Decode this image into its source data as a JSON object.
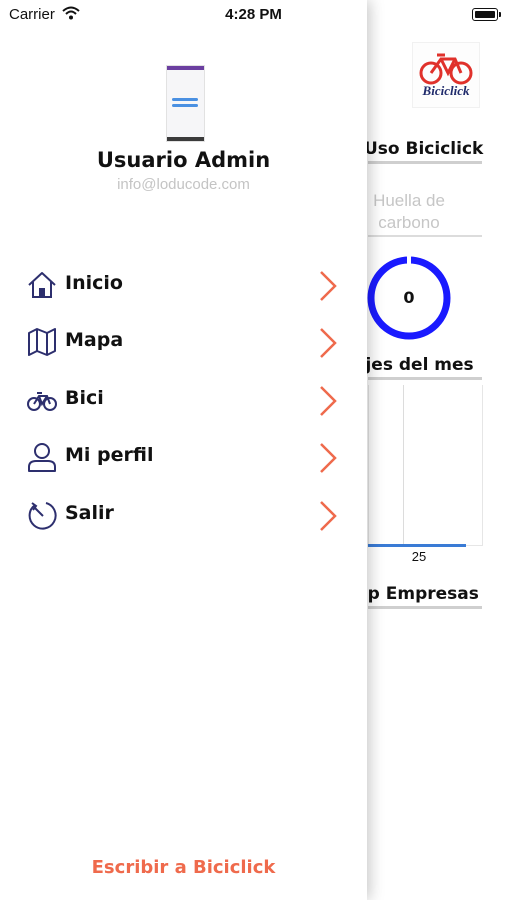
{
  "status_bar": {
    "carrier": "Carrier",
    "time": "4:28 PM"
  },
  "main": {
    "logo_text": "Biciclick",
    "uso_title": "Uso Biciclick",
    "huella_line1": "Huella de",
    "huella_line2": "carbono",
    "gauge_value": "0",
    "viajes_title": "ajes del mes",
    "chart_tick": "25",
    "empresas_title": "op Empresas"
  },
  "drawer": {
    "user_name": "Usuario Admin",
    "user_email": "info@loducode.com",
    "menu": [
      {
        "label": "Inicio",
        "icon": "home-icon"
      },
      {
        "label": "Mapa",
        "icon": "map-icon"
      },
      {
        "label": "Bici",
        "icon": "bicycle-icon"
      },
      {
        "label": "Mi perfil",
        "icon": "user-icon"
      },
      {
        "label": "Salir",
        "icon": "logout-icon"
      }
    ],
    "footer_link": "Escribir a Biciclick"
  },
  "colors": {
    "accent": "#ef6a4c",
    "icon": "#2d2f6e",
    "gauge": "#1a1aff",
    "chart_line": "#3a7bd5"
  }
}
